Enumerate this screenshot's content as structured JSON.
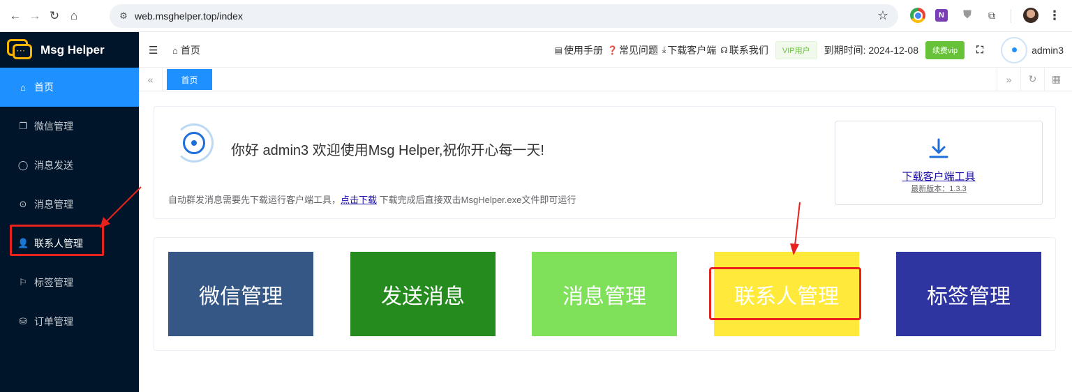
{
  "browser": {
    "url": "web.msghelper.top/index"
  },
  "app": {
    "name": "Msg Helper"
  },
  "sidebar": {
    "items": [
      {
        "label": "首页",
        "icon": "home-icon"
      },
      {
        "label": "微信管理",
        "icon": "copy-icon"
      },
      {
        "label": "消息发送",
        "icon": "chat-bubble-icon"
      },
      {
        "label": "消息管理",
        "icon": "chat-dots-icon"
      },
      {
        "label": "联系人管理",
        "icon": "user-icon"
      },
      {
        "label": "标签管理",
        "icon": "bookmark-icon"
      },
      {
        "label": "订单管理",
        "icon": "bag-icon"
      }
    ]
  },
  "header": {
    "breadcrumb": "首页",
    "links": {
      "manual": "使用手册",
      "faq": "常见问题",
      "download": "下载客户端",
      "contact": "联系我们"
    },
    "vip_badge": "VIP用户",
    "expire": "到期时间: 2024-12-08",
    "renew": "续费vip",
    "username": "admin3"
  },
  "tabs": {
    "home": "首页"
  },
  "welcome": {
    "text": "你好 admin3 欢迎使用Msg Helper,祝你开心每一天!",
    "hint_before": "自动群发消息需要先下载运行客户端工具，",
    "hint_link": "点击下载",
    "hint_after": " 下载完成后直接双击MsgHelper.exe文件即可运行"
  },
  "download_card": {
    "title": "下载客户端工具",
    "version": "最新版本：1.3.3"
  },
  "tiles": [
    {
      "label": "微信管理",
      "color": "#355785"
    },
    {
      "label": "发送消息",
      "color": "#268b1f"
    },
    {
      "label": "消息管理",
      "color": "#7fe05a"
    },
    {
      "label": "联系人管理",
      "color": "#ffe93a"
    },
    {
      "label": "标签管理",
      "color": "#2f35a0"
    }
  ],
  "colors": {
    "sidebar_bg": "#001529",
    "accent": "#1e90ff",
    "highlight": "#e8211d"
  }
}
